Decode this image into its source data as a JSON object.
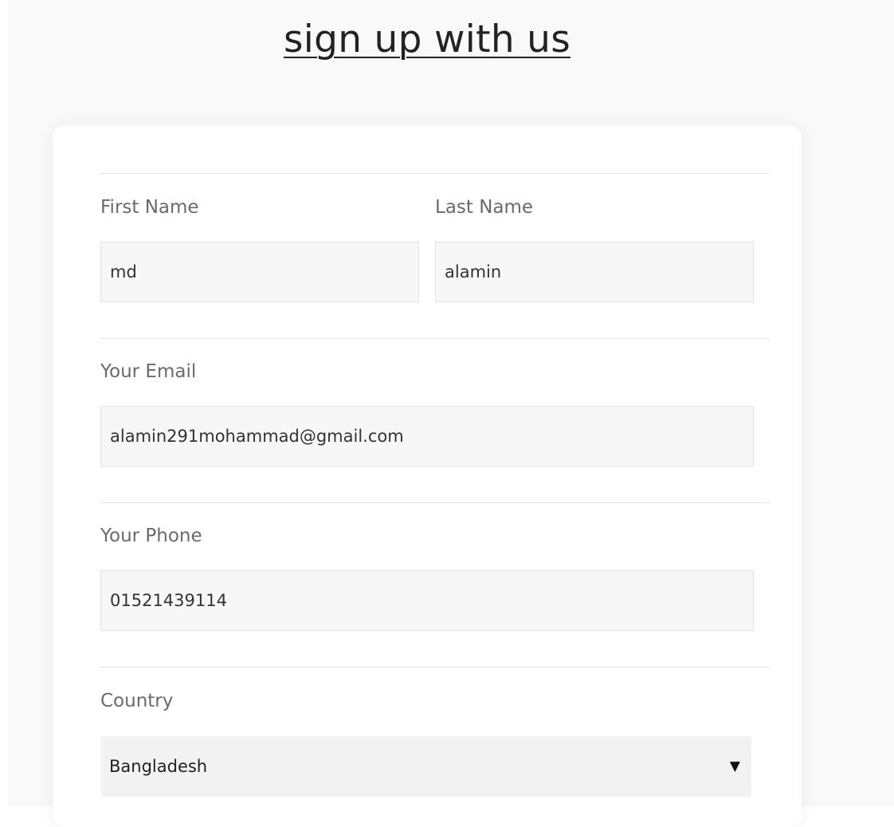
{
  "page": {
    "title": "sign up with us"
  },
  "form": {
    "first_name": {
      "label": "First Name",
      "value": "md"
    },
    "last_name": {
      "label": "Last Name",
      "value": "alamin"
    },
    "email": {
      "label": "Your Email",
      "value": "alamin291mohammad@gmail.com"
    },
    "phone": {
      "label": "Your Phone",
      "value": "01521439114"
    },
    "country": {
      "label": "Country",
      "selected": "Bangladesh",
      "arrow_icon": "dropdown-triangle-icon"
    }
  }
}
